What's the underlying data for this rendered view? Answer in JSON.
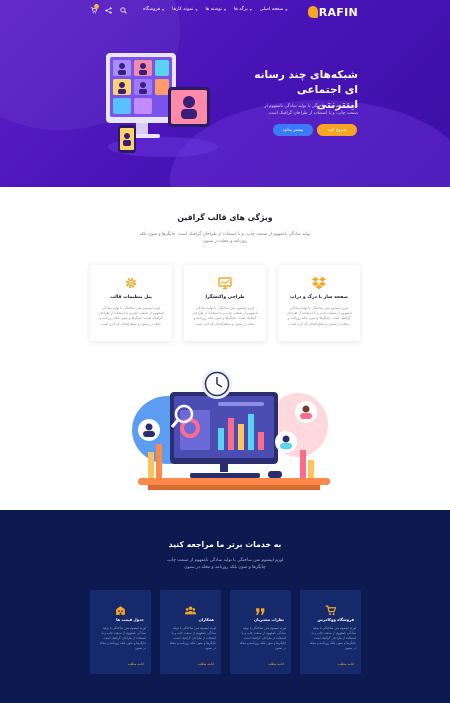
{
  "header": {
    "logo_text": "RAFIN",
    "menu": [
      {
        "label": "صفحه اصلی"
      },
      {
        "label": "برگه ها"
      },
      {
        "label": "نوشته ها"
      },
      {
        "label": "نمونه کارها"
      },
      {
        "label": "فروشگاه"
      }
    ],
    "cart_count": "0",
    "icons": [
      "cart-icon",
      "share-icon",
      "search-icon"
    ]
  },
  "hero": {
    "title": "شبکه‌های چند رسانه ای اجتماعی اینترنتی",
    "text": "لورم ایپسوم متن ساختگی با تولید سادگی نامفهوم از صنعت چاپ، و با استفاده از طراحان گرافیک است.",
    "primary_button": "شروع کنید",
    "secondary_button": "بیشتر بدانید"
  },
  "features": {
    "title": "ویژگی های قالب گرافین",
    "subtitle": "تولید سادگی نامفهوم از صنعت چاپ، و با استفاده از طراحان گرافیک است. چاپگرها و متون بلکه روزنامه و مجله در ستون",
    "cards": [
      {
        "icon": "dropbox-icon",
        "title": "صفحه ساز با درگ و دراپ",
        "text": "لورم ایپسوم متن ساختگی با تولید سادگی نامفهوم از صنعت چاپ و با استفاده از طراحان گرافیک است. چاپگرها و متون بلکه روزنامه و مجله در ستون و سطرآنچنان که لازم است"
      },
      {
        "icon": "monitor-icon",
        "title": "طراحی واکنشگرا",
        "text": "لورم ایپسوم متن ساختگی با تولید سادگی نامفهوم از صنعت چاپ و با استفاده از طراحان گرافیک است. چاپگرها و متون بلکه روزنامه و مجله در ستون و سطرآنچنان که لازم است"
      },
      {
        "icon": "gear-icon",
        "title": "پنل تنظیمات قالب",
        "text": "لورم ایپسوم متن ساختگی با تولید سادگی نامفهوم از صنعت چاپ و با استفاده از طراحان گرافیک است. چاپگرها و متون بلکه روزنامه و مجله در ستون و سطرآنچنان که لازم است"
      }
    ]
  },
  "services": {
    "title": "به خدمات برتر ما مراجعه کنید",
    "subtitle": "لورم ایپسوم متن ساختگی با تولید سادگی نامفهوم از صنعت چاپ، چاپگرها و متون بلکه روزنامه و مجله در ستون",
    "cards": [
      {
        "icon": "cart-icon",
        "title": "فروشگاه ووکامرس",
        "text": "لورم ایپسوم متن ساختگی با تولید سادگی نامفهوم از صنعت چاپ و با استفاده از طراحان گرافیک است. چاپگرها و متون بلکه روزنامه و مجله در ستون",
        "link": "ادامه مطلب"
      },
      {
        "icon": "quote-icon",
        "title": "نظرات مشتریان",
        "text": "لورم ایپسوم متن ساختگی با تولید سادگی نامفهوم از صنعت چاپ و با استفاده از طراحان گرافیک است. چاپگرها و متون بلکه روزنامه و مجله در ستون",
        "link": "ادامه مطلب"
      },
      {
        "icon": "users-icon",
        "title": "همکاران",
        "text": "لورم ایپسوم متن ساختگی با تولید سادگی نامفهوم از صنعت چاپ و با استفاده از طراحان گرافیک است. چاپگرها و متون بلکه روزنامه و مجله در ستون",
        "link": "ادامه مطلب"
      },
      {
        "icon": "building-icon",
        "title": "جدول قیمت ها",
        "text": "لورم ایپسوم متن ساختگی با تولید سادگی نامفهوم از صنعت چاپ و با استفاده از طراحان گرافیک است. چاپگرها و متون بلکه روزنامه و مجله در ستون",
        "link": "ادامه مطلب"
      }
    ]
  },
  "colors": {
    "hero_bg": "#4a14b8",
    "accent": "#f6a623",
    "blue_button": "#3d7bf6",
    "services_bg": "#0d1a4f",
    "service_card": "#16296b"
  }
}
